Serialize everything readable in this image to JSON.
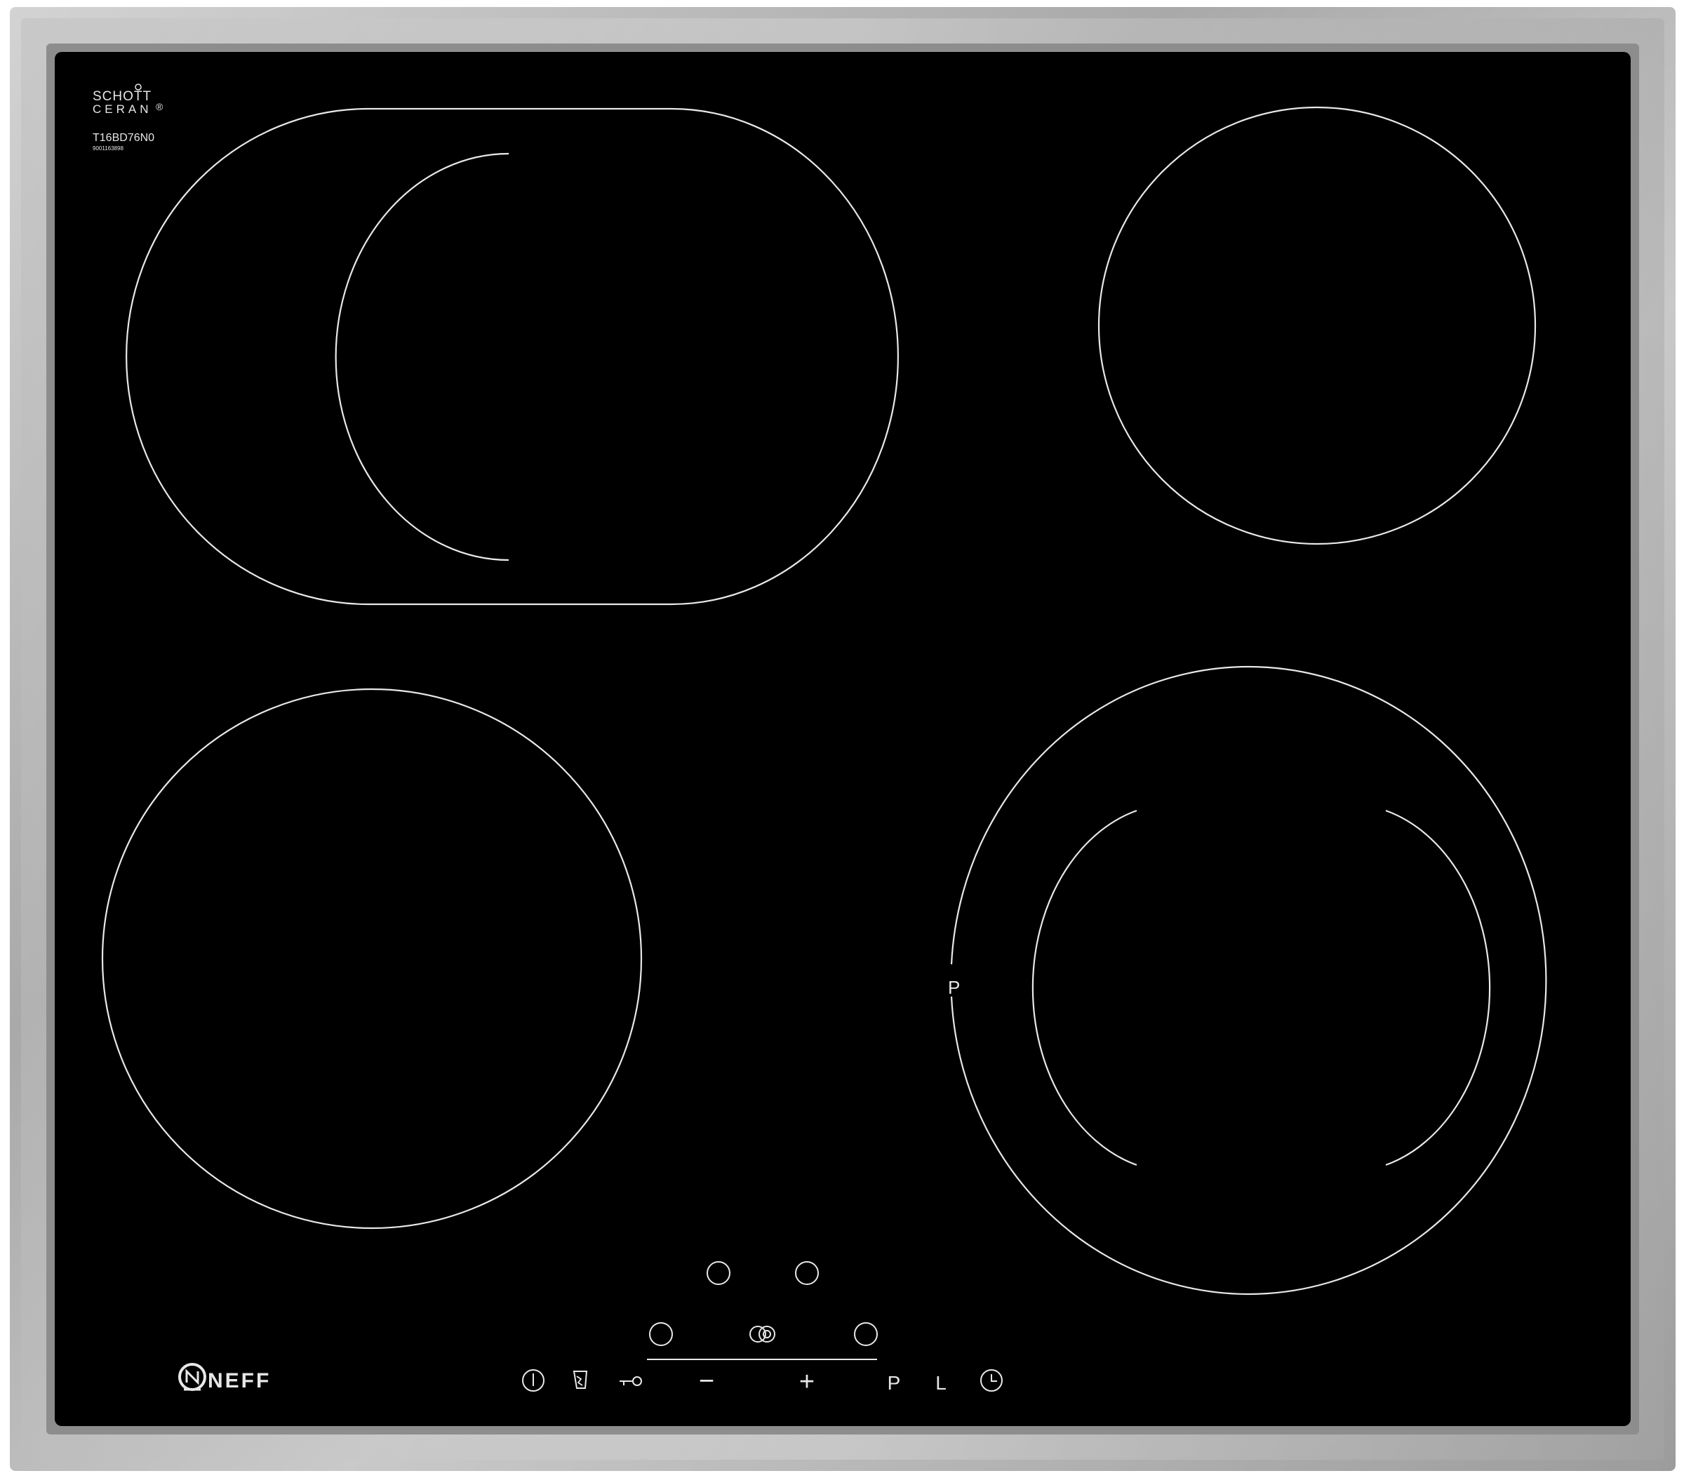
{
  "brand": {
    "glass_maker_line1": "SCHOTT",
    "glass_maker_line2": "CERAN",
    "registered_mark": "®",
    "model": "T16BD76N0",
    "serial": "9001163898",
    "manufacturer": "NEFF"
  },
  "zone_label": "P",
  "controls": {
    "power_icon": "power-icon",
    "pan_icon": "pan-icon",
    "lock_icon": "key-lock-icon",
    "minus": "−",
    "plus": "+",
    "program_label": "P",
    "level_label": "L",
    "timer_icon": "clock-icon",
    "dual_zone_icon": "dual-zone-icon"
  },
  "colors": {
    "frame": "#b9b9b9",
    "glass": "#000000",
    "markings": "#e8e8e8"
  }
}
